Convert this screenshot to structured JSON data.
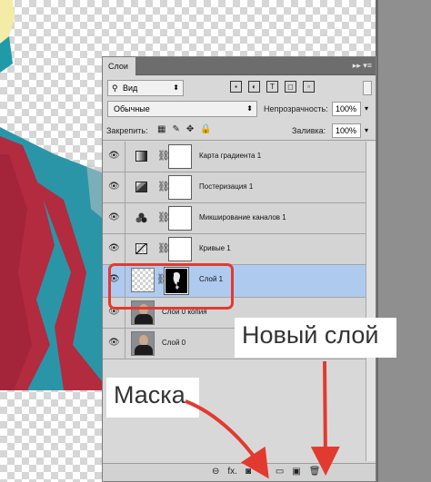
{
  "panel": {
    "tab_label": "Слои",
    "tab_menu": "▸▸ ▾≡",
    "filter_kind": "Вид",
    "blend_mode": "Обычные",
    "opacity_label": "Непрозрачность:",
    "opacity_value": "100%",
    "lock_label": "Закрепить:",
    "fill_label": "Заливка:",
    "fill_value": "100%"
  },
  "layers": [
    {
      "name": "Карта градиента 1",
      "icon": "gradient-map-icon"
    },
    {
      "name": "Постеризация 1",
      "icon": "posterize-icon"
    },
    {
      "name": "Микширование каналов 1",
      "icon": "channel-mixer-icon"
    },
    {
      "name": "Кривые 1",
      "icon": "curves-icon"
    },
    {
      "name": "Слой 1",
      "selected": true
    },
    {
      "name": "Слой 0 копия"
    },
    {
      "name": "Слой 0"
    }
  ],
  "callouts": {
    "new_layer": "Новый слой",
    "mask": "Маска"
  },
  "footer": {
    "link": "⊖",
    "fx": "fx.",
    "mask": "◙",
    "adjust": "◐.",
    "group": "▭",
    "new_layer": "▣",
    "delete": "🗑"
  },
  "colors": {
    "highlight": "#e23a2f",
    "selection": "#aecbef",
    "panel_bg": "#d8d8d8"
  }
}
